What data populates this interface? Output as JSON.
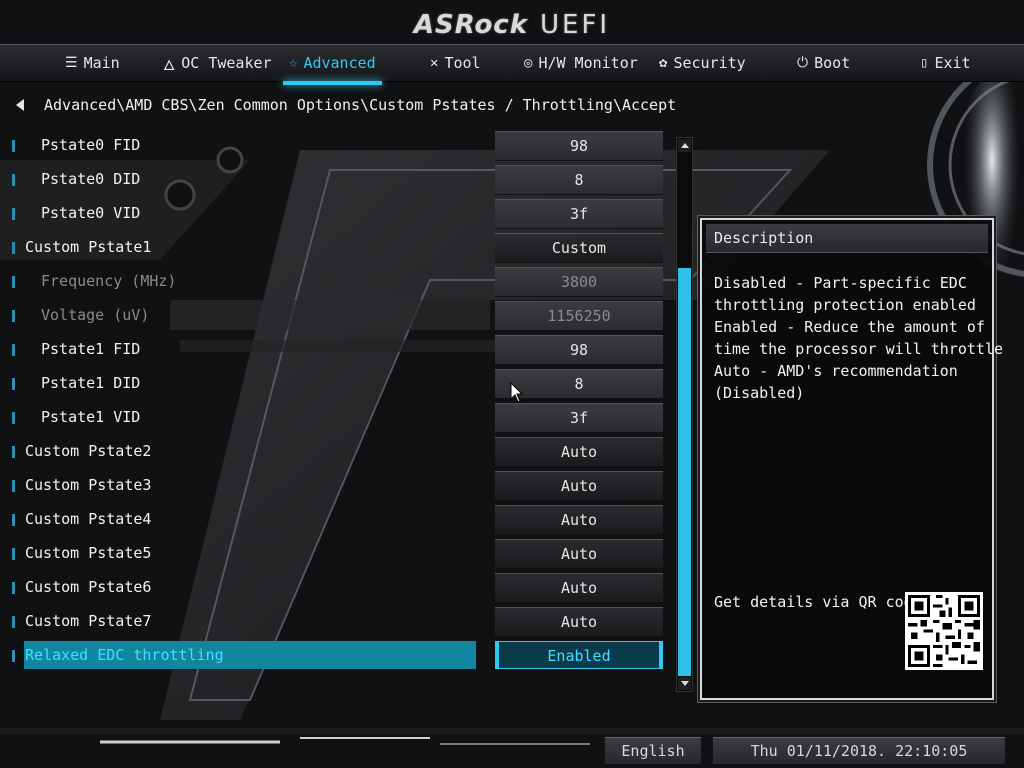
{
  "brand": {
    "logo_text": "ASRock",
    "suffix": "UEFI"
  },
  "nav": {
    "tabs": [
      {
        "label": "Main",
        "icon": "list-icon"
      },
      {
        "label": "OC Tweaker",
        "icon": "rocket-icon"
      },
      {
        "label": "Advanced",
        "icon": "star-icon",
        "active": true
      },
      {
        "label": "Tool",
        "icon": "tools-icon"
      },
      {
        "label": "H/W Monitor",
        "icon": "monitor-icon"
      },
      {
        "label": "Security",
        "icon": "shield-icon"
      },
      {
        "label": "Boot",
        "icon": "power-icon"
      },
      {
        "label": "Exit",
        "icon": "exit-door-icon"
      }
    ]
  },
  "breadcrumb": {
    "path": "Advanced\\AMD CBS\\Zen Common Options\\Custom Pstates / Throttling\\Accept"
  },
  "settings": [
    {
      "label": "Pstate0 FID",
      "value": "98"
    },
    {
      "label": "Pstate0 DID",
      "value": "8"
    },
    {
      "label": "Pstate0 VID",
      "value": "3f"
    },
    {
      "label": "Custom Pstate1",
      "value": "Custom"
    },
    {
      "label": "Frequency (MHz)",
      "value": "3800"
    },
    {
      "label": "Voltage (uV)",
      "value": "1156250"
    },
    {
      "label": "Pstate1 FID",
      "value": "98"
    },
    {
      "label": "Pstate1 DID",
      "value": "8"
    },
    {
      "label": "Pstate1 VID",
      "value": "3f"
    },
    {
      "label": "Custom Pstate2",
      "value": "Auto"
    },
    {
      "label": "Custom Pstate3",
      "value": "Auto"
    },
    {
      "label": "Custom Pstate4",
      "value": "Auto"
    },
    {
      "label": "Custom Pstate5",
      "value": "Auto"
    },
    {
      "label": "Custom Pstate6",
      "value": "Auto"
    },
    {
      "label": "Custom Pstate7",
      "value": "Auto"
    },
    {
      "label": "Relaxed EDC throttling",
      "value": "Enabled"
    }
  ],
  "description": {
    "title": "Description",
    "lines": [
      "Disabled - Part-specific EDC",
      "throttling protection enabled",
      "Enabled - Reduce the amount of",
      "time the processor will throttle",
      "Auto - AMD's recommendation",
      "(Disabled)"
    ],
    "qr_label": "Get details via QR code"
  },
  "footer": {
    "language": "English",
    "datetime": "Thu 01/11/2018. 22:10:05"
  },
  "colors": {
    "accent": "#2fc8f0",
    "selected_row": "#13869f"
  }
}
